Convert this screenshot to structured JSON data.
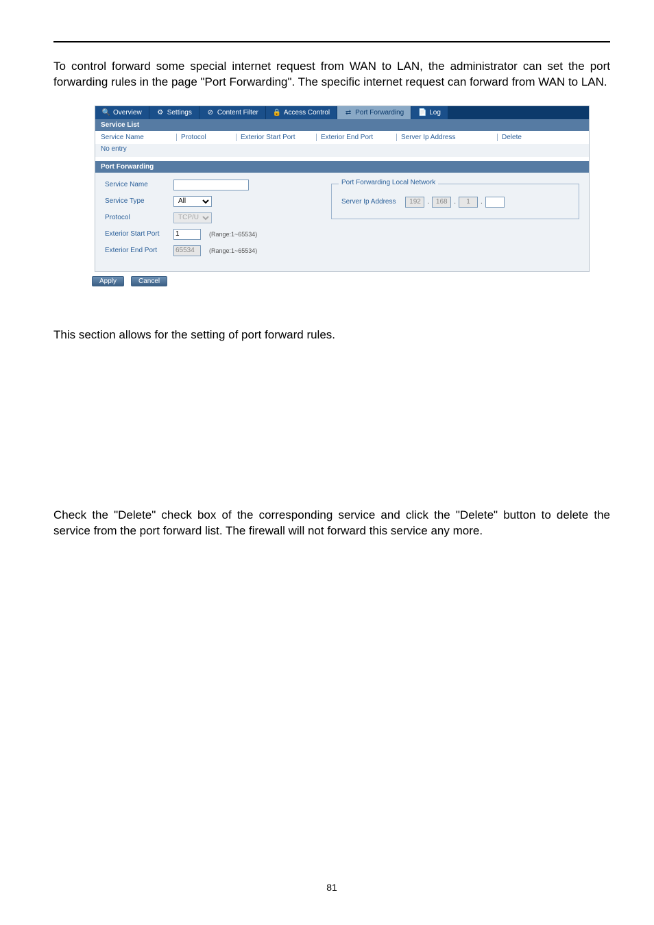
{
  "intro": "To control forward some special internet request from WAN to LAN, the administrator can set the port forwarding rules in the page \"Port Forwarding\". The specific internet request can forward from WAN to LAN.",
  "tabs": {
    "overview": "Overview",
    "settings": "Settings",
    "content_filter": "Content Filter",
    "access_control": "Access Control",
    "port_forwarding": "Port Forwarding",
    "log": "Log"
  },
  "service_list": {
    "title": "Service List",
    "headers": {
      "service_name": "Service Name",
      "protocol": "Protocol",
      "ext_start": "Exterior Start Port",
      "ext_end": "Exterior End Port",
      "server_ip": "Server Ip Address",
      "delete": "Delete"
    },
    "no_entry": "No entry"
  },
  "pf_form": {
    "title": "Port Forwarding",
    "labels": {
      "service_name": "Service Name",
      "service_type": "Service Type",
      "protocol": "Protocol",
      "ext_start": "Exterior Start Port",
      "ext_end": "Exterior End Port"
    },
    "values": {
      "service_name": "",
      "service_type": "All",
      "protocol": "TCP/UDP",
      "ext_start": "1",
      "ext_end": "65534"
    },
    "range_hint": "(Range:1~65534)",
    "fieldset_legend": "Port Forwarding Local Network",
    "server_ip_label": "Server Ip Address",
    "server_ip": {
      "o1": "192",
      "o2": "168",
      "o3": "1",
      "o4": ""
    }
  },
  "buttons": {
    "apply": "Apply",
    "cancel": "Cancel"
  },
  "para_after": "This section allows for the setting of port forward rules.",
  "para_delete": "Check the \"Delete\" check box of the corresponding service and click the \"Delete\" button to delete the service from the port forward list. The firewall will not forward this service any more.",
  "page_number": "81"
}
